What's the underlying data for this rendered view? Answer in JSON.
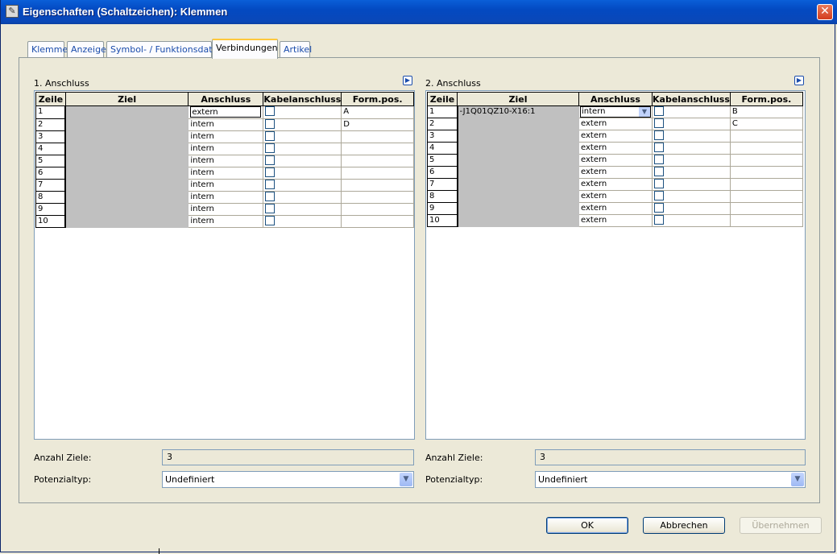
{
  "window": {
    "title": "Eigenschaften (Schaltzeichen): Klemmen",
    "close_symbol": "✕"
  },
  "tabs": [
    {
      "label": "Klemme",
      "active": false
    },
    {
      "label": "Anzeige",
      "active": false
    },
    {
      "label": "Symbol- / Funktionsdaten",
      "active": false
    },
    {
      "label": "Verbindungen",
      "active": true
    },
    {
      "label": "Artikel",
      "active": false
    }
  ],
  "columns": [
    "Zeile",
    "Ziel",
    "Anschluss",
    "Kabelanschluss",
    "Form.pos."
  ],
  "left": {
    "label": "1. Anschluss",
    "rows": [
      {
        "zeile": "1",
        "ziel": "",
        "anschluss": "extern",
        "formpos": "A"
      },
      {
        "zeile": "2",
        "ziel": "",
        "anschluss": "intern",
        "formpos": "D"
      },
      {
        "zeile": "3",
        "ziel": "",
        "anschluss": "intern",
        "formpos": ""
      },
      {
        "zeile": "4",
        "ziel": "",
        "anschluss": "intern",
        "formpos": ""
      },
      {
        "zeile": "5",
        "ziel": "",
        "anschluss": "intern",
        "formpos": ""
      },
      {
        "zeile": "6",
        "ziel": "",
        "anschluss": "intern",
        "formpos": ""
      },
      {
        "zeile": "7",
        "ziel": "",
        "anschluss": "intern",
        "formpos": ""
      },
      {
        "zeile": "8",
        "ziel": "",
        "anschluss": "intern",
        "formpos": ""
      },
      {
        "zeile": "9",
        "ziel": "",
        "anschluss": "intern",
        "formpos": ""
      },
      {
        "zeile": "10",
        "ziel": "",
        "anschluss": "intern",
        "formpos": ""
      }
    ],
    "anzahl_label": "Anzahl Ziele:",
    "anzahl_value": "3",
    "potenzial_label": "Potenzialtyp:",
    "potenzial_value": "Undefiniert"
  },
  "right": {
    "label": "2. Anschluss",
    "rows": [
      {
        "zeile": "1",
        "ziel": "-J1Q01QZ10-X16:1",
        "anschluss": "intern",
        "formpos": "B"
      },
      {
        "zeile": "2",
        "ziel": "",
        "anschluss": "extern",
        "formpos": "C"
      },
      {
        "zeile": "3",
        "ziel": "",
        "anschluss": "extern",
        "formpos": ""
      },
      {
        "zeile": "4",
        "ziel": "",
        "anschluss": "extern",
        "formpos": ""
      },
      {
        "zeile": "5",
        "ziel": "",
        "anschluss": "extern",
        "formpos": ""
      },
      {
        "zeile": "6",
        "ziel": "",
        "anschluss": "extern",
        "formpos": ""
      },
      {
        "zeile": "7",
        "ziel": "",
        "anschluss": "extern",
        "formpos": ""
      },
      {
        "zeile": "8",
        "ziel": "",
        "anschluss": "extern",
        "formpos": ""
      },
      {
        "zeile": "9",
        "ziel": "",
        "anschluss": "extern",
        "formpos": ""
      },
      {
        "zeile": "10",
        "ziel": "",
        "anschluss": "extern",
        "formpos": ""
      }
    ],
    "anzahl_label": "Anzahl Ziele:",
    "anzahl_value": "3",
    "potenzial_label": "Potenzialtyp:",
    "potenzial_value": "Undefiniert"
  },
  "buttons": {
    "ok": "OK",
    "cancel": "Abbrechen",
    "apply": "Übernehmen"
  },
  "icons": {
    "app": "pencil-properties-icon",
    "expand": "expand-arrow-icon",
    "dropdown": "chevron-down-icon"
  },
  "colors": {
    "titlebar": "#0349c1",
    "dialog_bg": "#ece9d8",
    "ziel_cell_bg": "#c0c0c0",
    "tab_highlight": "#ffc83c"
  }
}
